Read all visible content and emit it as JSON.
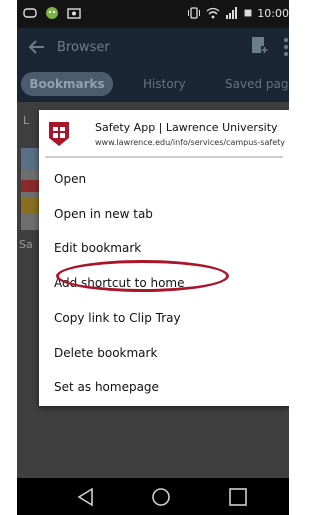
{
  "status_bar": {
    "time": "10:00"
  },
  "app_bar": {
    "title": "Browser"
  },
  "tabs": [
    {
      "label": "Bookmarks"
    },
    {
      "label": "History"
    },
    {
      "label": "Saved pages"
    }
  ],
  "background": {
    "label_l": "L",
    "label_sa": "Sa"
  },
  "menu": {
    "site_title": "Safety App | Lawrence University",
    "site_url": "www.lawrence.edu/info/services/campus-safety",
    "items": [
      {
        "label": "Open"
      },
      {
        "label": "Open in new tab"
      },
      {
        "label": "Edit bookmark"
      },
      {
        "label": "Add shortcut to home"
      },
      {
        "label": "Copy link to Clip Tray"
      },
      {
        "label": "Delete bookmark"
      },
      {
        "label": "Set as homepage"
      }
    ]
  },
  "colors": {
    "brand_red": "#a8162a",
    "appbar": "#1a2633",
    "tab_active": "#4c5c6e"
  }
}
